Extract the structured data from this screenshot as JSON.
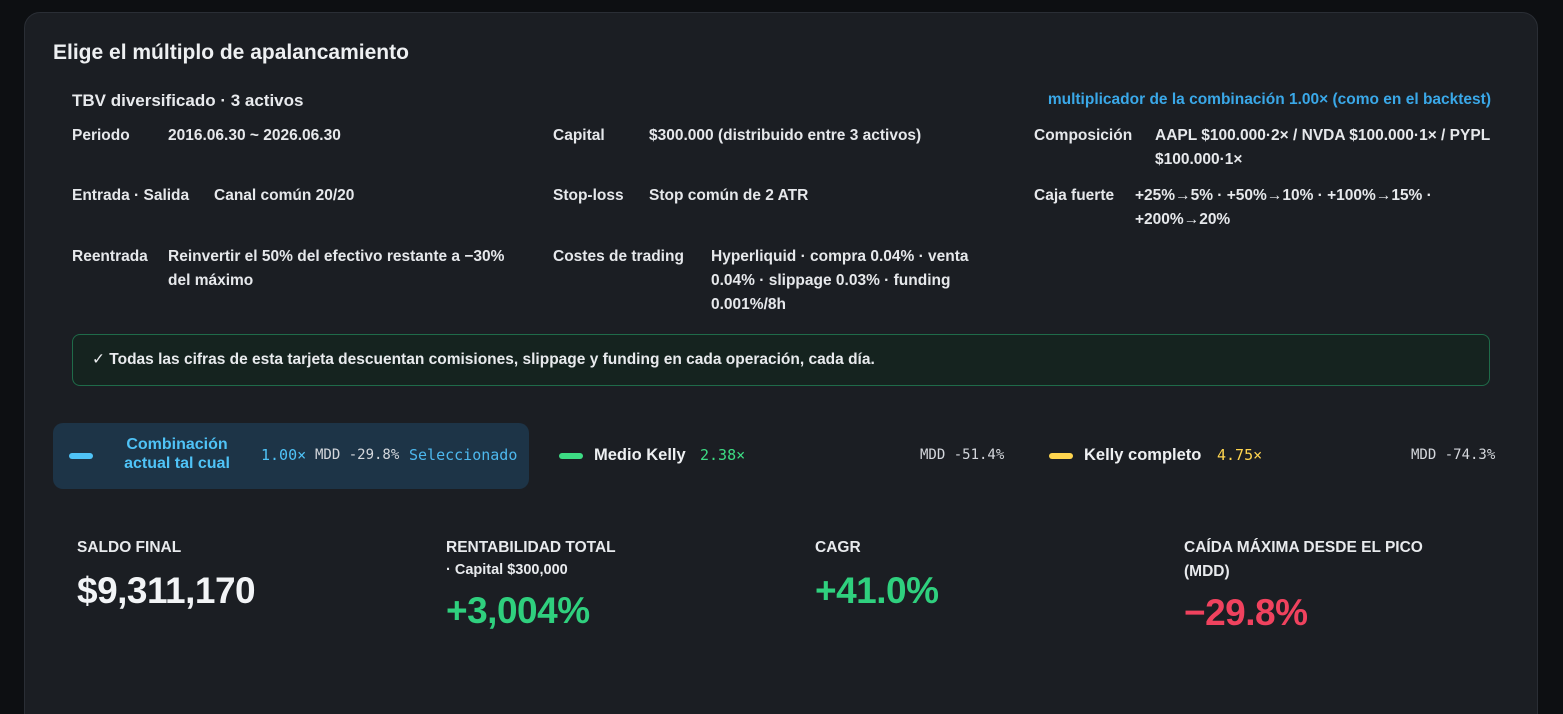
{
  "card": {
    "title": "Elige el múltiplo de apalancamiento",
    "subtitle": "TBV diversificado · 3 activos",
    "multiplier_note": "multiplicador de la combinación 1.00× (como en el backtest)"
  },
  "info": {
    "period_label": "Periodo",
    "period_value": "2016.06.30 ~ 2026.06.30",
    "capital_label": "Capital",
    "capital_value": "$300.000 (distribuido entre 3 activos)",
    "composition_label": "Composición",
    "composition_value": "AAPL $100.000·2× / NVDA $100.000·1× / PYPL $100.000·1×",
    "entry_label": "Entrada · Salida",
    "entry_value": "Canal común 20/20",
    "stoploss_label": "Stop-loss",
    "stoploss_value": "Stop común de 2 ATR",
    "safe_label": "Caja fuerte",
    "safe_value": "+25%→5% · +50%→10% · +100%→15% · +200%→20%",
    "reentry_label": "Reentrada",
    "reentry_value": "Reinvertir el 50% del efectivo restante a −30% del máximo",
    "costs_label": "Costes de trading",
    "costs_value": "Hyperliquid · compra 0.04% · venta 0.04% · slippage 0.03% · funding 0.001%/8h"
  },
  "notice": "✓ Todas las cifras de esta tarjeta descuentan comisiones, slippage y funding en cada operación, cada día.",
  "options": {
    "current": {
      "name": "Combinación actual tal cual",
      "multiplier": "1.00×",
      "mdd": "MDD -29.8%",
      "selected_label": "Seleccionado",
      "color": "#4fc3f7"
    },
    "half_kelly": {
      "name": "Medio Kelly",
      "multiplier": "2.38×",
      "mdd": "MDD -51.4%",
      "color": "#3ddc84"
    },
    "full_kelly": {
      "name": "Kelly completo",
      "multiplier": "4.75×",
      "mdd": "MDD -74.3%",
      "color": "#ffd54f"
    }
  },
  "stats": {
    "final_balance_label": "SALDO FINAL",
    "final_balance_value": "$9,311,170",
    "total_return_label": "RENTABILIDAD TOTAL",
    "total_return_sub": "· Capital $300,000",
    "total_return_value": "+3,004%",
    "cagr_label": "CAGR",
    "cagr_value": "+41.0%",
    "mdd_label": "CAÍDA MÁXIMA DESDE EL PICO (MDD)",
    "mdd_value": "−29.8%",
    "positive_color": "#2fd07e",
    "negative_color": "#f0425e"
  }
}
